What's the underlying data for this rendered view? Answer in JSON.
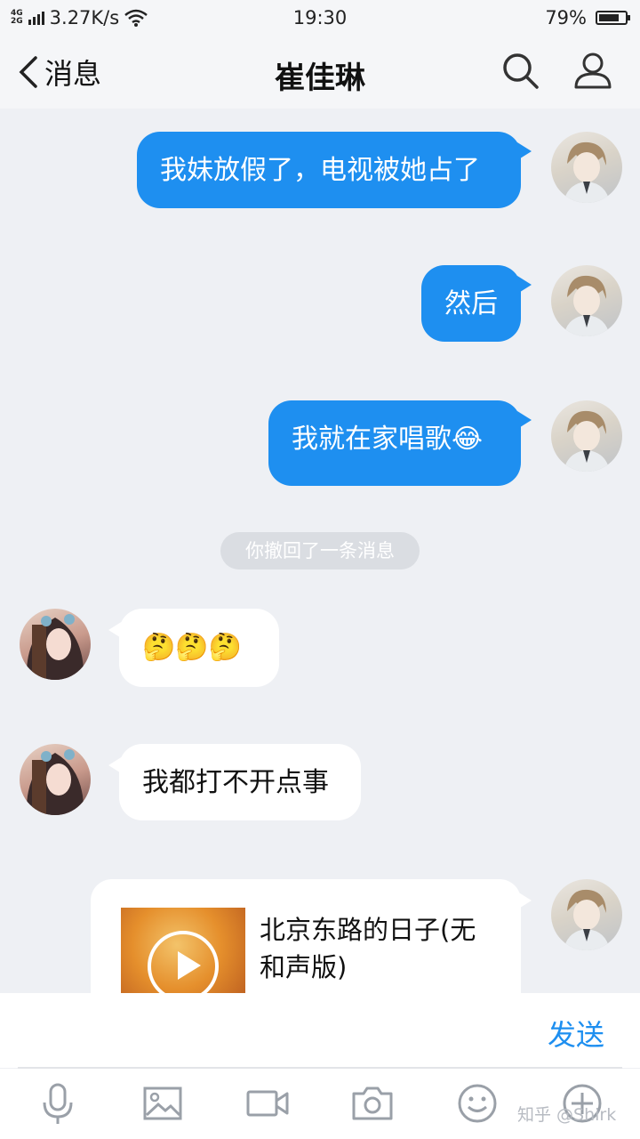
{
  "status_bar": {
    "network": "4G 2G",
    "speed": "3.27K/s",
    "time": "19:30",
    "battery": "79%",
    "battery_level": 0.79
  },
  "header": {
    "back_label": "消息",
    "title": "崔佳琳"
  },
  "messages": {
    "m1": "我妹放假了，电视被她占了",
    "m2": "然后",
    "m3": "我就在家唱歌😂",
    "system": "你撤回了一条消息",
    "m4": "🤔🤔🤔",
    "m5": "我都打不开点事",
    "music_title": "北京东路的日子(无和声版)"
  },
  "input": {
    "send_label": "发送"
  },
  "toolbar": {
    "icons": [
      "mic-icon",
      "image-icon",
      "video-icon",
      "camera-icon",
      "emoji-icon",
      "plus-icon"
    ]
  },
  "watermark": "知乎 @Shirk",
  "colors": {
    "accent": "#1e8ff0",
    "background": "#eef0f4"
  }
}
